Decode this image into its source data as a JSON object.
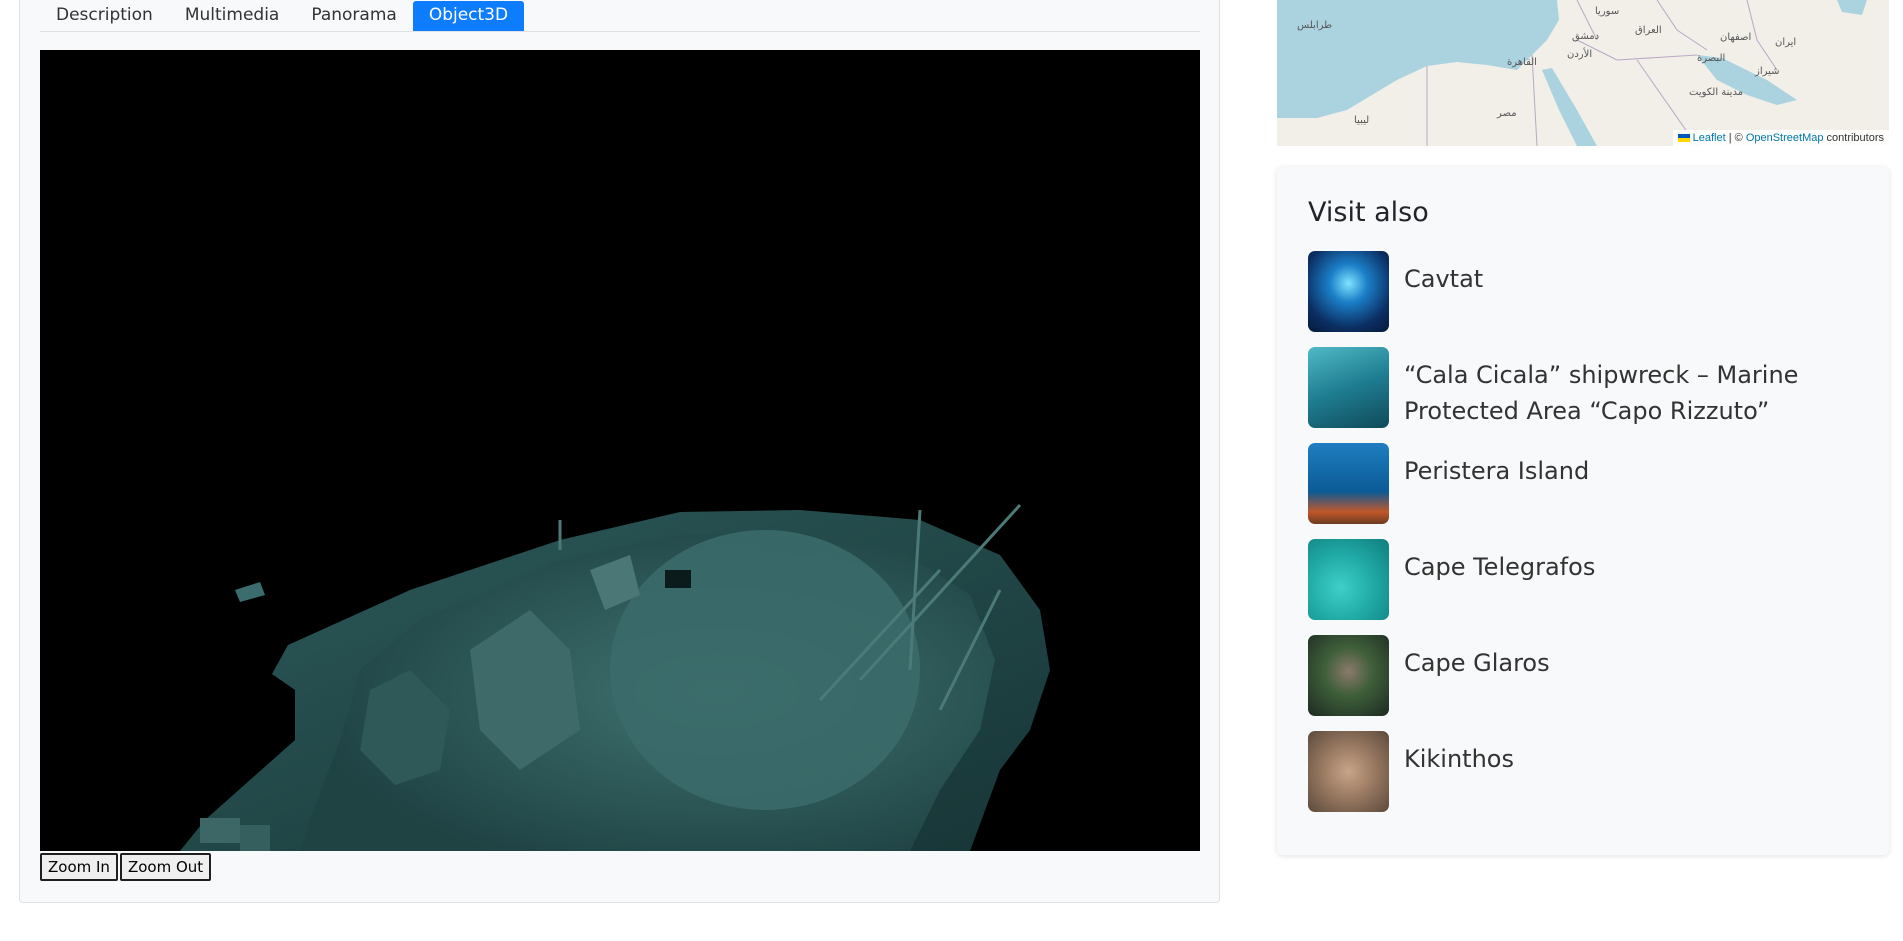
{
  "tabs": [
    {
      "label": "Description",
      "active": false
    },
    {
      "label": "Multimedia",
      "active": false
    },
    {
      "label": "Panorama",
      "active": false
    },
    {
      "label": "Object3D",
      "active": true
    }
  ],
  "viewer": {
    "zoom_in_label": "Zoom In",
    "zoom_out_label": "Zoom Out"
  },
  "map": {
    "labels": [
      "طرابلس",
      "دمشق",
      "سوريا",
      "العراق",
      "الأردن",
      "القاهرة",
      "مصر",
      "ليبيا",
      "اصفهان",
      "ایران",
      "البصرة",
      "شيراز",
      "مدينة الكويت"
    ],
    "attribution": {
      "leaflet": "Leaflet",
      "separator": " | © ",
      "osm": "OpenStreetMap",
      "suffix": " contributors"
    }
  },
  "visit_also": {
    "title": "Visit also",
    "items": [
      {
        "name": "Cavtat",
        "thumb": "blue-cave-photo"
      },
      {
        "name": "“Cala Cicala” shipwreck – Marine Protected Area “Capo Rizzuto”",
        "thumb": "diver-wreck-photo"
      },
      {
        "name": "Peristera Island",
        "thumb": "diver-reef-photo"
      },
      {
        "name": "Cape Telegrafos",
        "thumb": "teal-seabed-photo"
      },
      {
        "name": "Cape Glaros",
        "thumb": "sea-plants-photo"
      },
      {
        "name": "Kikinthos",
        "thumb": "coral-photo"
      }
    ]
  },
  "colors": {
    "active_tab": "#0d7cff",
    "card_bg": "#f8f9fa",
    "sea": "#aad3df",
    "wreck": "#2f5e5f"
  }
}
